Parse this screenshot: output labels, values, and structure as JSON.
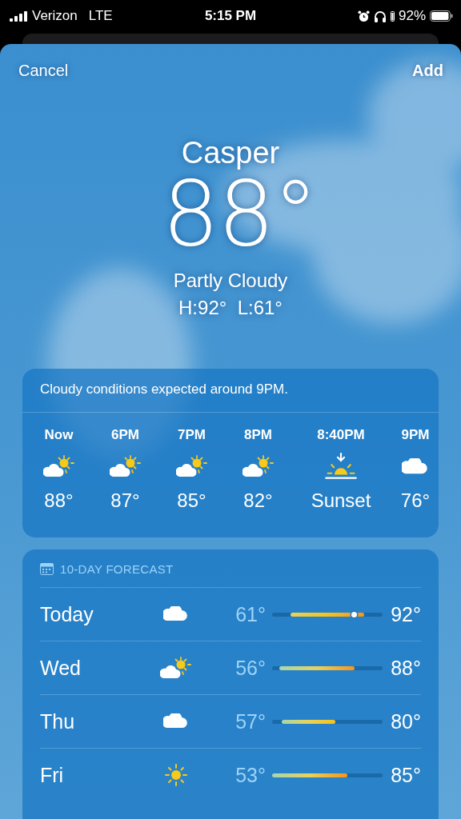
{
  "status_bar": {
    "carrier": "Verizon",
    "network": "LTE",
    "time": "5:15 PM",
    "battery": "92%"
  },
  "nav": {
    "cancel": "Cancel",
    "add": "Add"
  },
  "current": {
    "city": "Casper",
    "temperature": "88°",
    "condition": "Partly Cloudy",
    "high_low": "H:92°  L:61°"
  },
  "hourly": {
    "summary": "Cloudy conditions expected around 9PM.",
    "items": [
      {
        "time": "Now",
        "kind": "partly_cloudy",
        "value": "88°"
      },
      {
        "time": "6PM",
        "kind": "partly_cloudy",
        "value": "87°"
      },
      {
        "time": "7PM",
        "kind": "partly_cloudy",
        "value": "85°"
      },
      {
        "time": "8PM",
        "kind": "partly_cloudy",
        "value": "82°"
      },
      {
        "time": "8:40PM",
        "kind": "sunset",
        "value": "Sunset"
      },
      {
        "time": "9PM",
        "kind": "cloudy",
        "value": "76°"
      }
    ]
  },
  "forecast": {
    "title": "10-DAY FORECAST",
    "days": [
      {
        "day": "Today",
        "kind": "cloudy",
        "low": "61°",
        "high": "92°",
        "shows_current": true
      },
      {
        "day": "Wed",
        "kind": "partly_cloudy",
        "low": "56°",
        "high": "88°",
        "shows_current": false
      },
      {
        "day": "Thu",
        "kind": "cloudy",
        "low": "57°",
        "high": "80°",
        "shows_current": false
      },
      {
        "day": "Fri",
        "kind": "sunny",
        "low": "53°",
        "high": "85°",
        "shows_current": false
      }
    ]
  }
}
